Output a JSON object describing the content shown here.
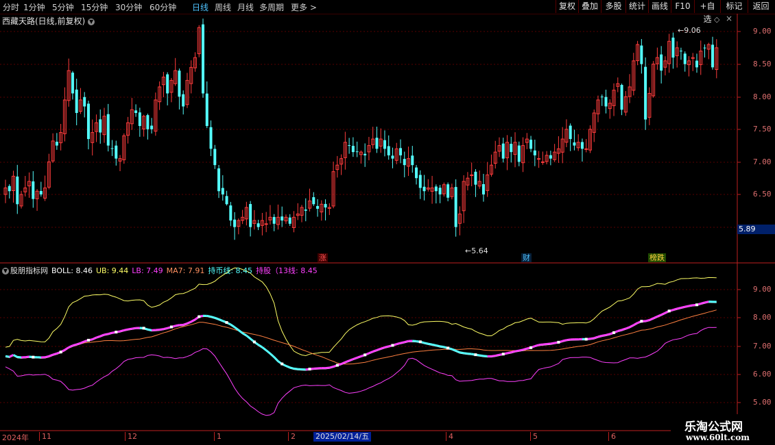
{
  "toolbar": {
    "timeframes": [
      {
        "label": "分时",
        "active": false
      },
      {
        "label": "1分钟",
        "active": false
      },
      {
        "label": "5分钟",
        "active": false
      },
      {
        "label": "15分钟",
        "active": false
      },
      {
        "label": "30分钟",
        "active": false
      },
      {
        "label": "60分钟",
        "active": false
      },
      {
        "label": "日线",
        "active": true
      },
      {
        "label": "周线",
        "active": false
      },
      {
        "label": "月线",
        "active": false
      },
      {
        "label": "多周期",
        "active": false
      },
      {
        "label": "更多 >",
        "active": false
      }
    ],
    "buttons": [
      "复权",
      "叠加",
      "多股",
      "统计",
      "画线",
      "F10",
      "+自选",
      "标记",
      "返回"
    ]
  },
  "stock_title": "西藏天路(日线,前复权)",
  "price_axis": [
    "9.00",
    "8.50",
    "8.00",
    "7.50",
    "7.00",
    "6.50"
  ],
  "current_price": "5.89",
  "annotations": {
    "high": "9.06",
    "low": "5.64"
  },
  "event_badges": [
    {
      "label": "涨",
      "color": "#e84040",
      "bg": "#5a0000"
    },
    {
      "label": "财",
      "color": "#4fc3ff",
      "bg": "#06203a"
    },
    {
      "label": "榜跌",
      "color": "#ffd040",
      "bg": "#2a5a00"
    }
  ],
  "indicator": {
    "name": "股朋指标网",
    "boll": "BOLL: 8.46",
    "ub": "UB: 9.44",
    "lb": "LB: 7.49",
    "ma7": "MA7: 7.91",
    "chibi": "持币线: 8.45",
    "chigu": "持股（13线: 8.45",
    "axis": [
      "9.00",
      "8.00",
      "7.00",
      "6.00",
      "5.00"
    ]
  },
  "dates": {
    "year": "2024年",
    "months": [
      "11",
      "12",
      "1",
      "2",
      "4",
      "5",
      "6"
    ],
    "cursor": "2025/02/14/五"
  },
  "watermark": {
    "name": "乐淘公式网",
    "url": "www.60lt.com"
  },
  "colors": {
    "up": "#ff3c3c",
    "down": "#54ffff",
    "ub": "#ffff66",
    "boll": "#ffffff",
    "lb": "#ff40ff",
    "ma7": "#ff8040",
    "grid": "#8a0000"
  },
  "chart_data": {
    "type": "candlestick",
    "ylim": [
      5.4,
      9.3
    ],
    "closes": [
      6.6,
      6.55,
      6.78,
      6.35,
      6.5,
      6.6,
      6.7,
      6.43,
      6.55,
      6.5,
      6.6,
      7.0,
      7.32,
      7.25,
      7.45,
      7.95,
      8.4,
      8.05,
      7.75,
      7.95,
      7.85,
      7.35,
      7.45,
      7.6,
      7.45,
      7.7,
      7.25,
      7.2,
      7.05,
      7.05,
      7.4,
      7.6,
      7.8,
      7.75,
      7.55,
      7.7,
      7.5,
      7.5,
      7.95,
      8.15,
      8.3,
      8.05,
      8.25,
      8.4,
      8.0,
      7.85,
      8.25,
      8.45,
      8.6,
      9.06,
      8.05,
      7.55,
      7.2,
      6.95,
      6.55,
      6.5,
      6.35,
      6.1,
      6.0,
      6.1,
      6.15,
      6.3,
      6.0,
      6.1,
      6.0,
      6.1,
      6.05,
      6.15,
      6.05,
      6.15,
      6.1,
      6.15,
      6.05,
      6.15,
      6.2,
      6.3,
      6.25,
      6.4,
      6.35,
      6.28,
      6.35,
      6.3,
      6.3,
      6.85,
      6.95,
      7.05,
      7.3,
      7.25,
      7.15,
      7.15,
      7.15,
      7.1,
      7.25,
      7.35,
      7.2,
      7.35,
      7.2,
      7.1,
      7.05,
      7.2,
      7.1,
      6.95,
      7.05,
      6.95,
      6.75,
      6.6,
      6.55,
      6.6,
      6.6,
      6.55,
      6.5,
      6.65,
      6.45,
      6.6,
      6.0,
      6.2,
      6.7,
      6.75,
      6.8,
      6.65,
      6.7,
      6.5,
      6.8,
      6.95,
      7.15,
      7.25,
      7.05,
      7.3,
      7.15,
      7.3,
      7.0,
      7.25,
      7.35,
      7.2,
      7.1,
      7.05,
      7.0,
      7.1,
      7.05,
      7.15,
      7.2,
      7.35,
      7.5,
      7.35,
      7.25,
      7.3,
      7.2,
      7.2,
      7.5,
      7.75,
      7.95,
      8.0,
      7.85,
      7.9,
      8.1,
      8.2,
      7.8,
      8.0,
      8.15,
      8.55,
      8.8,
      8.5,
      7.65,
      8.05,
      8.5,
      8.6,
      8.4,
      8.55,
      8.85,
      8.6,
      8.75,
      8.7,
      8.5,
      8.55,
      8.6,
      8.45,
      8.7,
      8.75,
      8.8,
      8.45,
      8.75
    ],
    "x_months": [
      "11",
      "12",
      "1",
      "2",
      "4",
      "5",
      "6"
    ]
  }
}
